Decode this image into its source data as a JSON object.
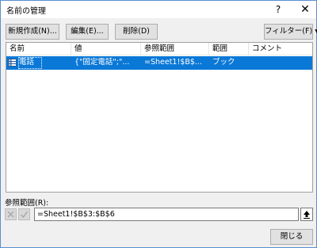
{
  "window": {
    "title": "名前の管理",
    "help_label": "?",
    "close_label": "✕"
  },
  "toolbar": {
    "new_label": "新規作成(N)...",
    "edit_label": "編集(E)...",
    "delete_label": "削除(D)",
    "filter_label": "フィルター(F)",
    "filter_arrow": "▾"
  },
  "list": {
    "columns": [
      "名前",
      "値",
      "参照範囲",
      "範囲",
      "コメント"
    ],
    "rows": [
      {
        "name": "電話",
        "value": "{\"固定電話\";\"...",
        "refers_to": "=Sheet1!$B$...",
        "scope": "ブック",
        "comment": ""
      }
    ],
    "selection_color": "#0a78d7"
  },
  "refers_to": {
    "label": "参照範囲(R):",
    "value": "=Sheet1!$B$3:$B$6"
  },
  "footer": {
    "close_label": "閉じる"
  }
}
